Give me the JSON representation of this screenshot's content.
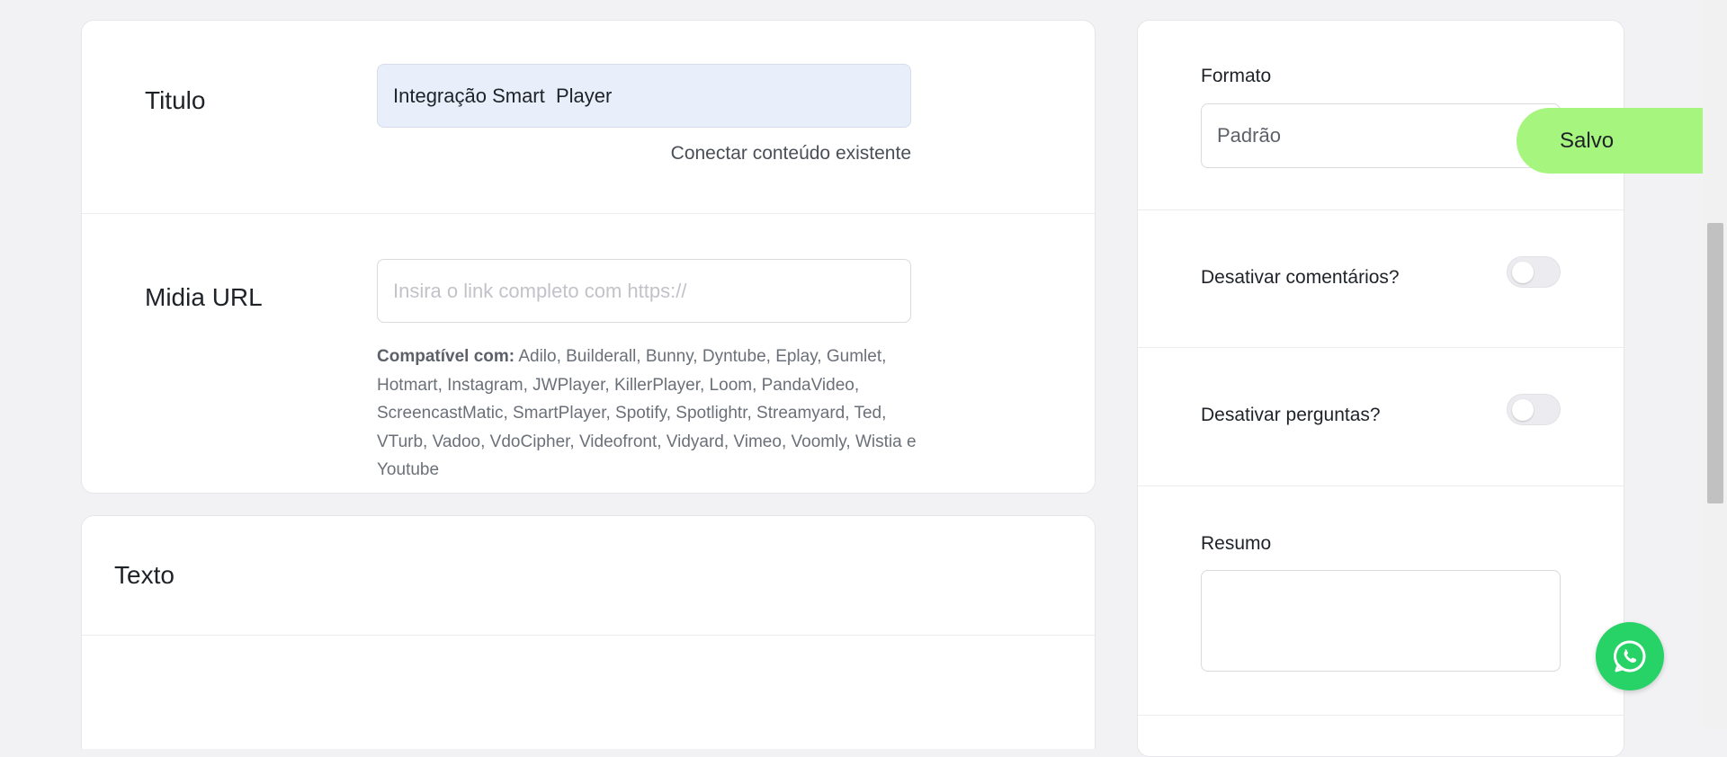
{
  "main_card": {
    "title_label": "Titulo",
    "title_value": "Integração Smart  Player",
    "connect_link": "Conectar conteúdo existente",
    "media_label": "Midia URL",
    "media_placeholder": "Insira o link completo com https://",
    "compat_prefix": "Compatível com:",
    "compat_list": "Adilo, Builderall, Bunny, Dyntube, Eplay, Gumlet, Hotmart, Instagram, JWPlayer, KillerPlayer, Loom, PandaVideo, ScreencastMatic, SmartPlayer, Spotify, Spotlightr, Streamyard, Ted, VTurb, Vadoo, VdoCipher, Videofront, Vidyard, Vimeo, Voomly, Wistia e Youtube"
  },
  "text_card": {
    "heading": "Texto"
  },
  "sidebar": {
    "format_label": "Formato",
    "format_value": "Padrão",
    "disable_comments_label": "Desativar comentários?",
    "disable_comments_on": false,
    "disable_questions_label": "Desativar perguntas?",
    "disable_questions_on": false,
    "summary_label": "Resumo",
    "summary_value": ""
  },
  "toast": {
    "text": "Salvo",
    "color": "#a5f57e"
  },
  "fab": {
    "icon": "whatsapp-icon",
    "color": "#27d367"
  }
}
